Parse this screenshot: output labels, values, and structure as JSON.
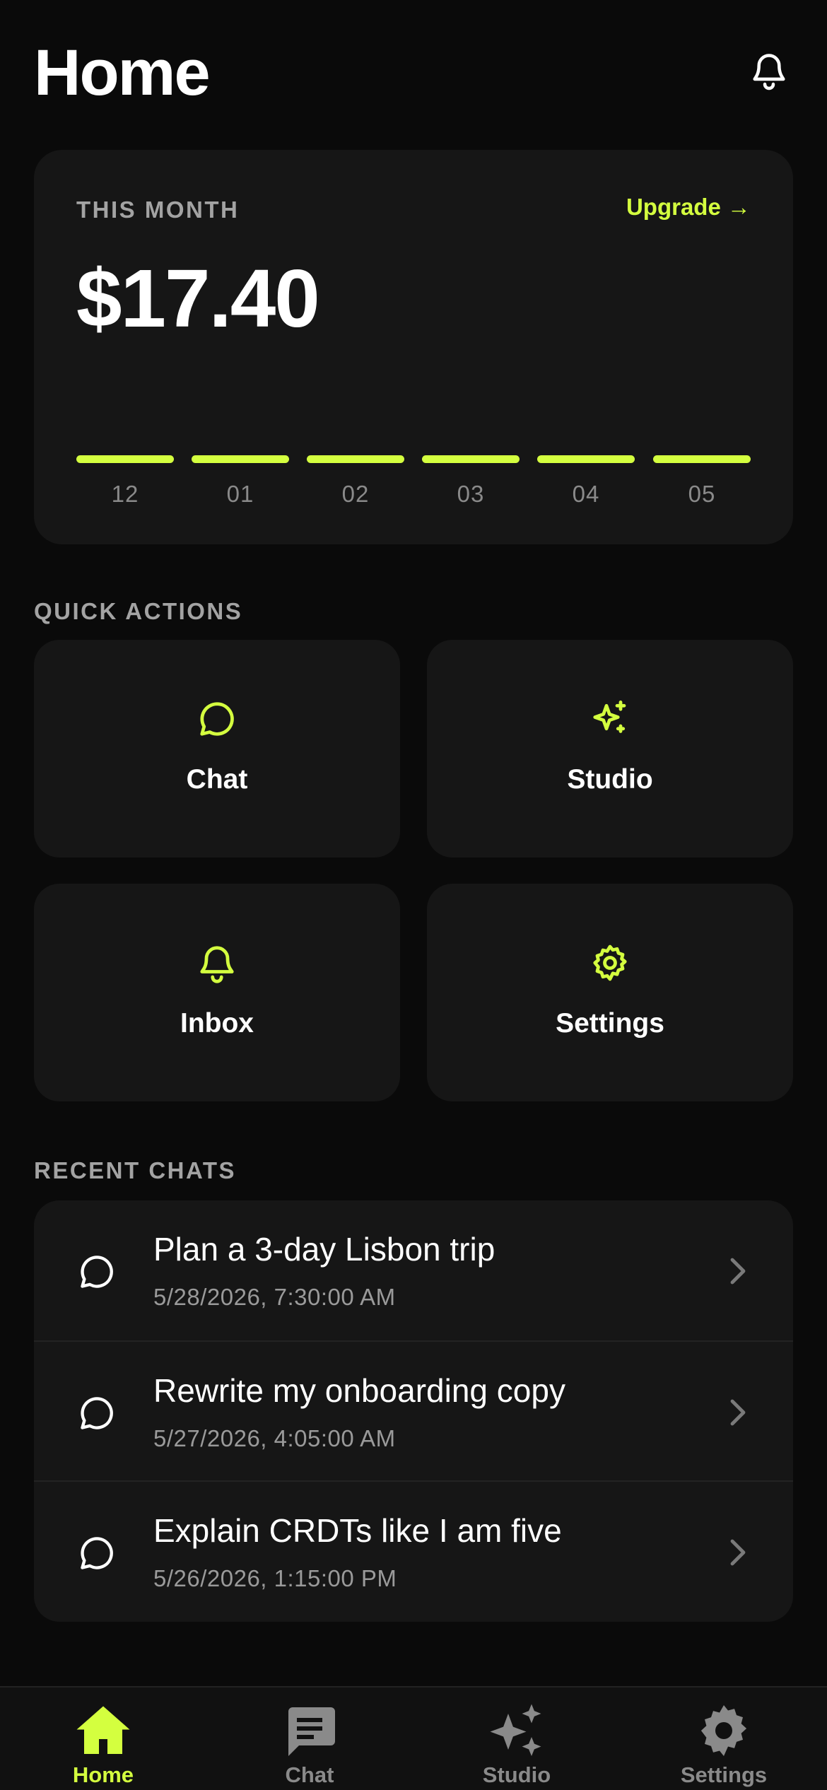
{
  "colors": {
    "accent": "#d4ff3f",
    "background": "#0a0a0a",
    "card": "#161616",
    "muted": "#a3a3a3"
  },
  "header": {
    "title": "Home",
    "icon": "bell-icon"
  },
  "month_card": {
    "label": "THIS MONTH",
    "upgrade_label": "Upgrade →",
    "amount": "$17.40",
    "months": [
      "12",
      "01",
      "02",
      "03",
      "04",
      "05"
    ]
  },
  "quick_actions": {
    "label": "QUICK ACTIONS",
    "items": [
      {
        "label": "Chat",
        "icon": "chat-bubble-icon"
      },
      {
        "label": "Studio",
        "icon": "sparkles-icon"
      },
      {
        "label": "Inbox",
        "icon": "bell-icon"
      },
      {
        "label": "Settings",
        "icon": "gear-icon"
      }
    ]
  },
  "recent_chats": {
    "label": "RECENT CHATS",
    "items": [
      {
        "title": "Plan a 3-day Lisbon trip",
        "time": "5/28/2026, 7:30:00 AM"
      },
      {
        "title": "Rewrite my onboarding copy",
        "time": "5/27/2026, 4:05:00 AM"
      },
      {
        "title": "Explain CRDTs like I am five",
        "time": "5/26/2026, 1:15:00 PM"
      }
    ]
  },
  "tabbar": {
    "items": [
      {
        "label": "Home",
        "icon": "home-icon",
        "active": true
      },
      {
        "label": "Chat",
        "icon": "message-icon",
        "active": false
      },
      {
        "label": "Studio",
        "icon": "sparkles-icon",
        "active": false
      },
      {
        "label": "Settings",
        "icon": "gear-icon",
        "active": false
      }
    ]
  }
}
